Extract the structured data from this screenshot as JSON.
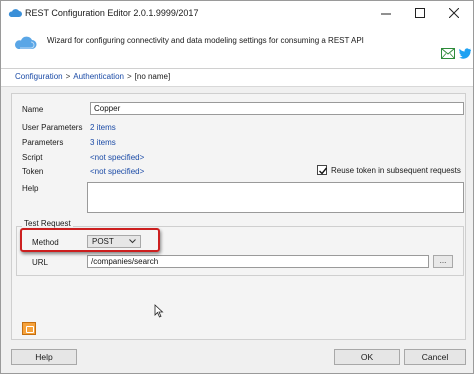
{
  "window": {
    "title": "REST Configuration Editor 2.0.1.9999/2017"
  },
  "header": {
    "description": "Wizard for configuring connectivity and data modeling settings for consuming a REST API",
    "icons": {
      "mail": "mail-icon",
      "twitter": "twitter-icon",
      "app": "cloud-icon"
    }
  },
  "breadcrumb": {
    "items": [
      "Configuration",
      "Authentication",
      "[no name]"
    ],
    "separator": ">"
  },
  "form": {
    "name_label": "Name",
    "name_value": "Copper",
    "user_params_label": "User Parameters",
    "user_params_value": "2 items",
    "params_label": "Parameters",
    "params_value": "3 items",
    "script_label": "Script",
    "script_value": "<not specified>",
    "token_label": "Token",
    "token_value": "<not specified>",
    "reuse_token_label": "Reuse token in subsequent requests",
    "reuse_token_checked": true,
    "help_label": "Help",
    "help_value": ""
  },
  "test_request": {
    "caption": "Test Request",
    "method_label": "Method",
    "method_value": "POST",
    "url_label": "URL",
    "url_value": "/companies/search",
    "browse_label": "..."
  },
  "buttons": {
    "help": "Help",
    "ok": "OK",
    "cancel": "Cancel"
  },
  "colors": {
    "link": "#1a4aa6",
    "highlight": "#cc1f1f",
    "accent_icon": "#f6a13a"
  }
}
